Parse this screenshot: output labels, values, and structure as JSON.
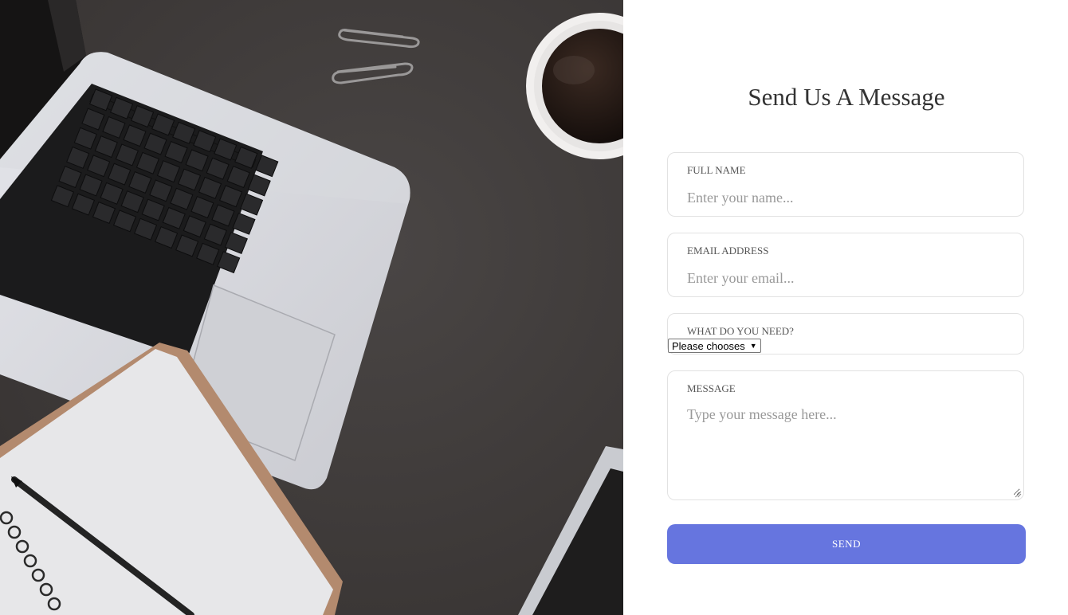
{
  "form": {
    "title": "Send Us A Message",
    "fields": {
      "name": {
        "label": "FULL NAME",
        "placeholder": "Enter your name..."
      },
      "email": {
        "label": "EMAIL ADDRESS",
        "placeholder": "Enter your email..."
      },
      "need": {
        "label": "WHAT DO YOU NEED?",
        "selected": "Please chooses"
      },
      "message": {
        "label": "MESSAGE",
        "placeholder": "Type your message here..."
      }
    },
    "send_label": "SEND"
  },
  "colors": {
    "accent": "#6675df",
    "desk": "#3f3b3a",
    "field_border": "#e2e2e2"
  },
  "hero": {
    "icon": "desk-photo"
  }
}
